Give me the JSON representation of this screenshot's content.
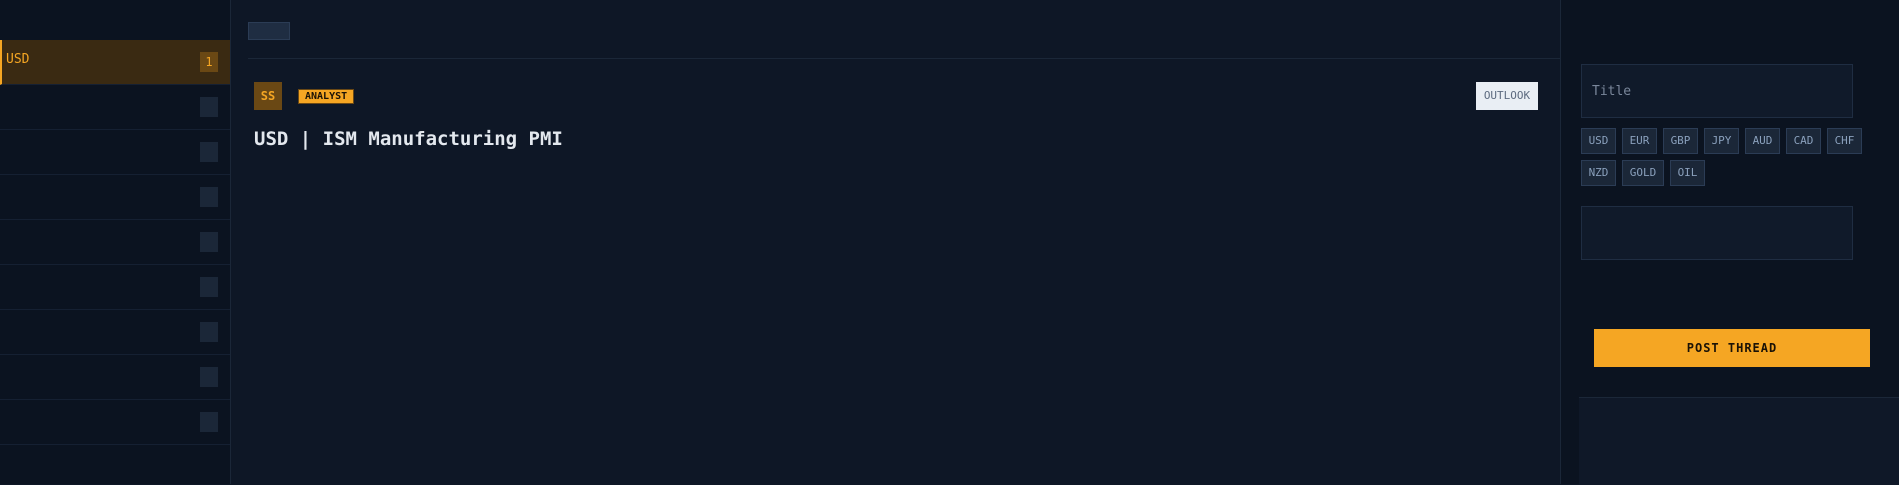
{
  "left": {
    "header": "",
    "items": [
      {
        "label": "USD",
        "count": "1",
        "active": true
      },
      {
        "label": "",
        "count": "",
        "active": false
      },
      {
        "label": "",
        "count": "",
        "active": false
      },
      {
        "label": "",
        "count": "",
        "active": false
      },
      {
        "label": "",
        "count": "",
        "active": false
      },
      {
        "label": "",
        "count": "",
        "active": false
      },
      {
        "label": "",
        "count": "",
        "active": false
      },
      {
        "label": "",
        "count": "",
        "active": false
      },
      {
        "label": "",
        "count": "",
        "active": false
      }
    ]
  },
  "center": {
    "tabs": [
      "",
      ""
    ],
    "post": {
      "avatar": "SS",
      "author": "",
      "badge": "ANALYST",
      "date": "",
      "outlook_button": "OUTLOOK",
      "title": "USD | ISM Manufacturing PMI",
      "stats": "",
      "body": "",
      "reply_prompt": "",
      "vote_up": "",
      "vote_text": ""
    }
  },
  "right": {
    "section_new_thread": "",
    "title_placeholder": "Title",
    "chips": [
      "USD",
      "EUR",
      "GBP",
      "JPY",
      "AUD",
      "CAD",
      "CHF",
      "NZD",
      "GOLD",
      "OIL"
    ],
    "body_placeholder": "",
    "helper_text": "",
    "post_button": "POST THREAD",
    "section_stats": ""
  }
}
